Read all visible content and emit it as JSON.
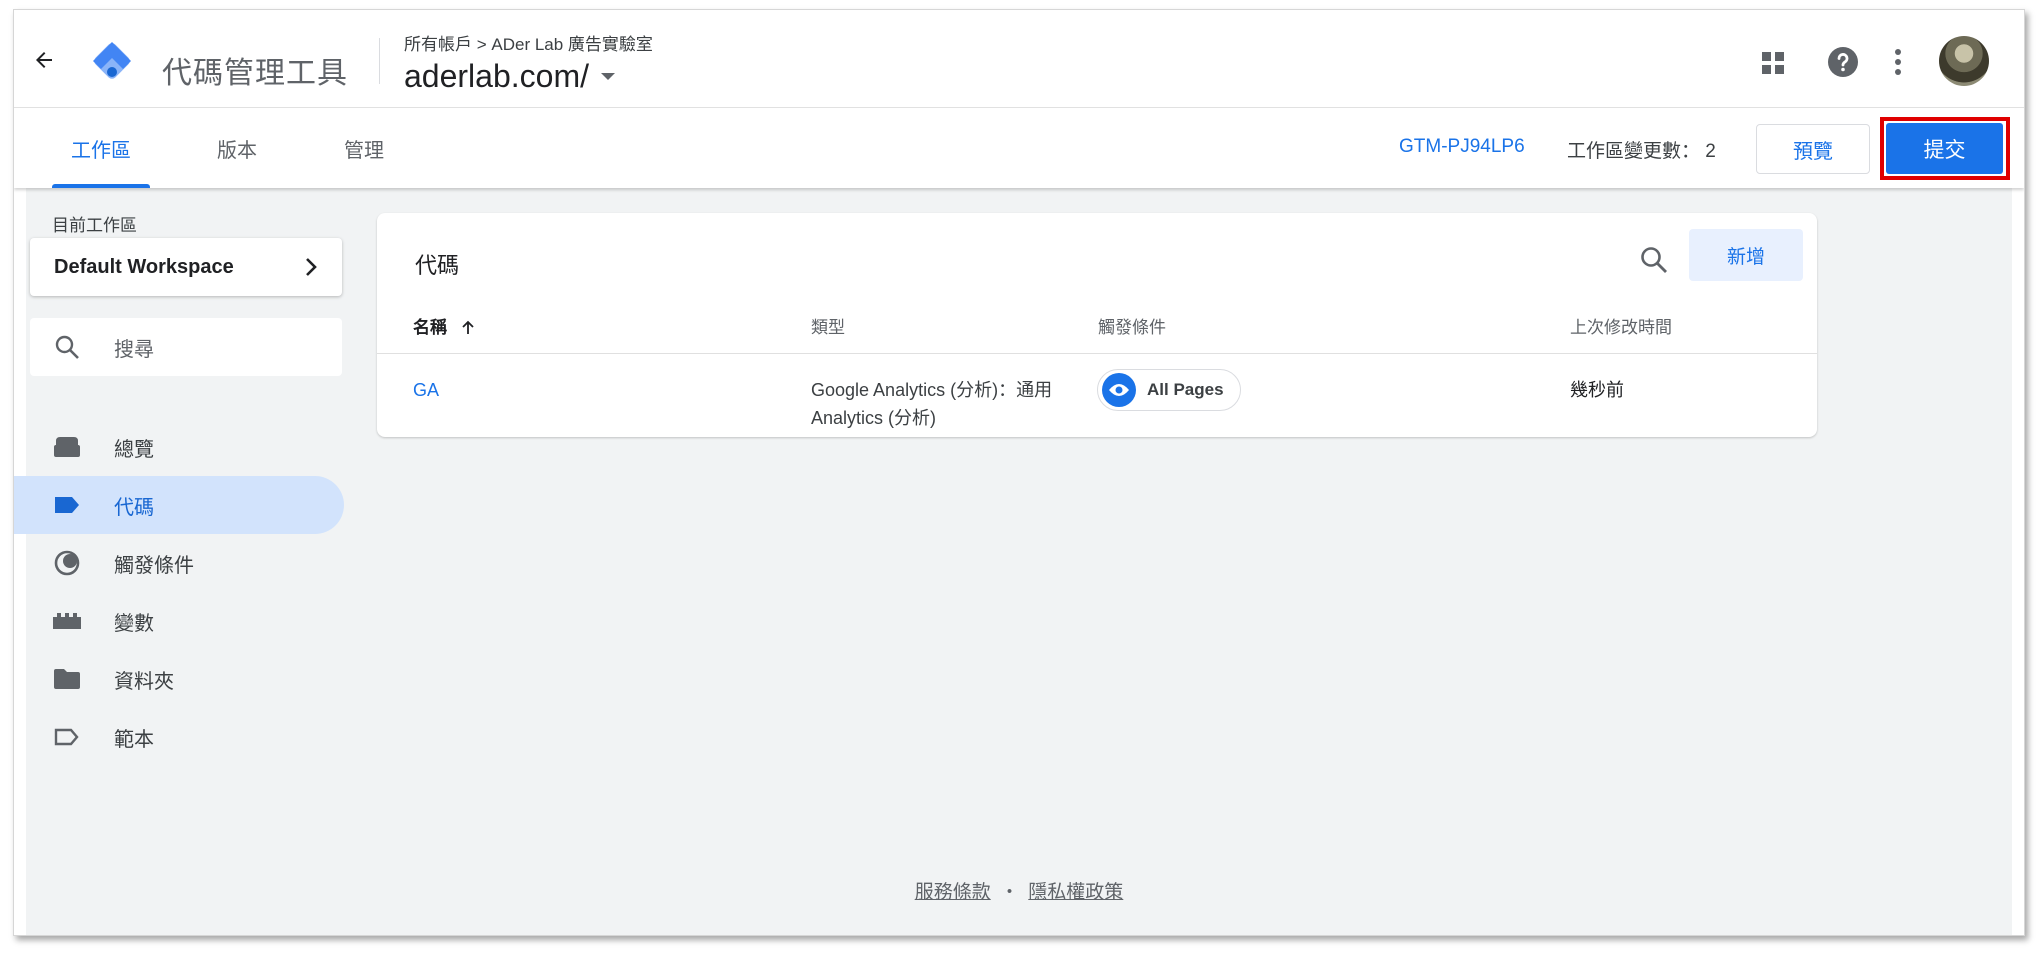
{
  "app": {
    "product_title": "代碼管理工具",
    "breadcrumb": "所有帳戶 > ADer Lab 廣告實驗室",
    "container_name": "aderlab.com/",
    "brand_color": "#1a73e8"
  },
  "tabs": [
    {
      "label": "工作區",
      "active": true
    },
    {
      "label": "版本",
      "active": false
    },
    {
      "label": "管理",
      "active": false
    }
  ],
  "toolbar": {
    "container_id": "GTM-PJ94LP6",
    "workspace_changes": "工作區變更數： 2",
    "preview_label": "預覽",
    "submit_label": "提交",
    "highlight_color": "#e00000"
  },
  "sidebar": {
    "workspace_label": "目前工作區",
    "workspace_name": "Default Workspace",
    "search_placeholder": "搜尋",
    "items": [
      {
        "label": "總覽",
        "icon": "briefcase-icon",
        "active": false
      },
      {
        "label": "代碼",
        "icon": "tag-icon",
        "active": true
      },
      {
        "label": "觸發條件",
        "icon": "trigger-icon",
        "active": false
      },
      {
        "label": "變數",
        "icon": "variables-icon",
        "active": false
      },
      {
        "label": "資料夾",
        "icon": "folder-icon",
        "active": false
      },
      {
        "label": "範本",
        "icon": "template-icon",
        "active": false
      }
    ]
  },
  "tags_card": {
    "title": "代碼",
    "new_label": "新增",
    "columns": {
      "name": "名稱",
      "type": "類型",
      "trigger": "觸發條件",
      "modified": "上次修改時間"
    },
    "rows": [
      {
        "name": "GA",
        "type_line1": "Google Analytics (分析)：通用",
        "type_line2": "Analytics (分析)",
        "trigger": "All Pages",
        "modified": "幾秒前"
      }
    ]
  },
  "footer": {
    "terms": "服務條款",
    "separator": "・",
    "privacy": "隱私權政策"
  }
}
